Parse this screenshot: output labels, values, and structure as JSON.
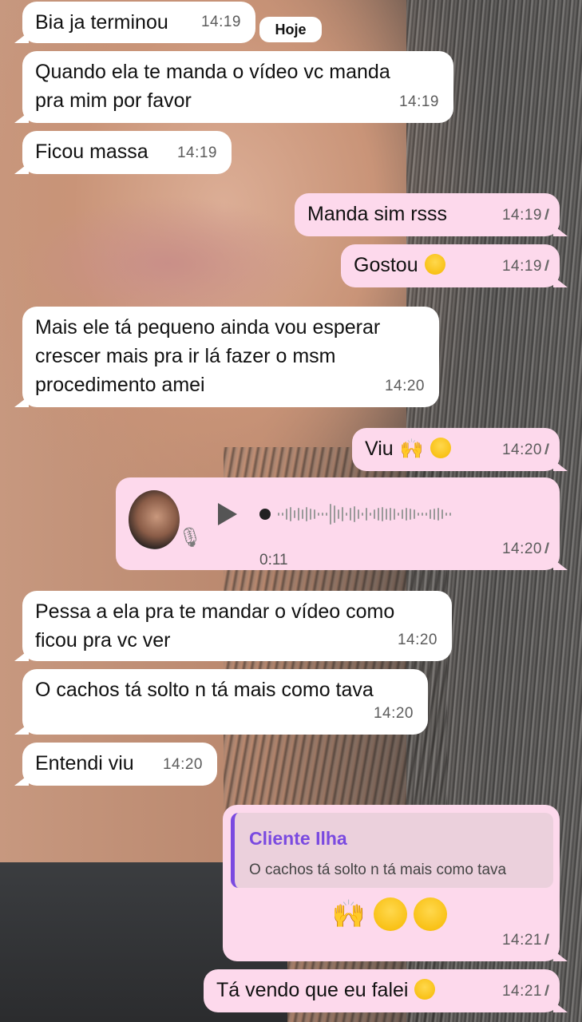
{
  "date_badge": "Hoje",
  "messages": [
    {
      "text": "Bia ja terminou",
      "time": "14:19"
    },
    {
      "text": "Quando ela te manda o  vídeo vc manda\npra mim por favor",
      "time": "14:19"
    },
    {
      "text": "Ficou massa",
      "time": "14:19"
    },
    {
      "text": "Manda sim rsss",
      "time": "14:19",
      "status": "//"
    },
    {
      "text": "Gostou",
      "time": "14:19",
      "status": "//",
      "emoji": "grinning-sweat-emoji"
    },
    {
      "text": "Mais ele tá pequeno ainda vou esperar\ncrescer mais pra ir lá fazer o msm\nprocedimento amei",
      "time": "14:20"
    },
    {
      "text": "Viu",
      "time": "14:20",
      "status": "//",
      "emoji": "raised-hands-emoji, smiling-blush-emoji"
    },
    {
      "audio_duration": "0:11",
      "time": "14:20",
      "status": "//"
    },
    {
      "text": "Pessa a ela pra te mandar o vídeo como\nficou pra vc ver",
      "time": "14:20"
    },
    {
      "text": "O cachos tá solto n tá mais como tava",
      "time": "14:20"
    },
    {
      "text": "Entendi viu",
      "time": "14:20"
    },
    {
      "reply_name": "Cliente Ilha",
      "reply_text": "O cachos tá solto n tá mais como tava",
      "time": "14:21",
      "status": "//"
    },
    {
      "text": "Tá vendo que eu falei",
      "time": "14:21",
      "status": "//",
      "emoji": "tears-of-joy-emoji"
    }
  ],
  "colors": {
    "incoming": "#ffffff",
    "outgoing": "#fdd9ec",
    "reply_accent": "#7a4ae0"
  }
}
